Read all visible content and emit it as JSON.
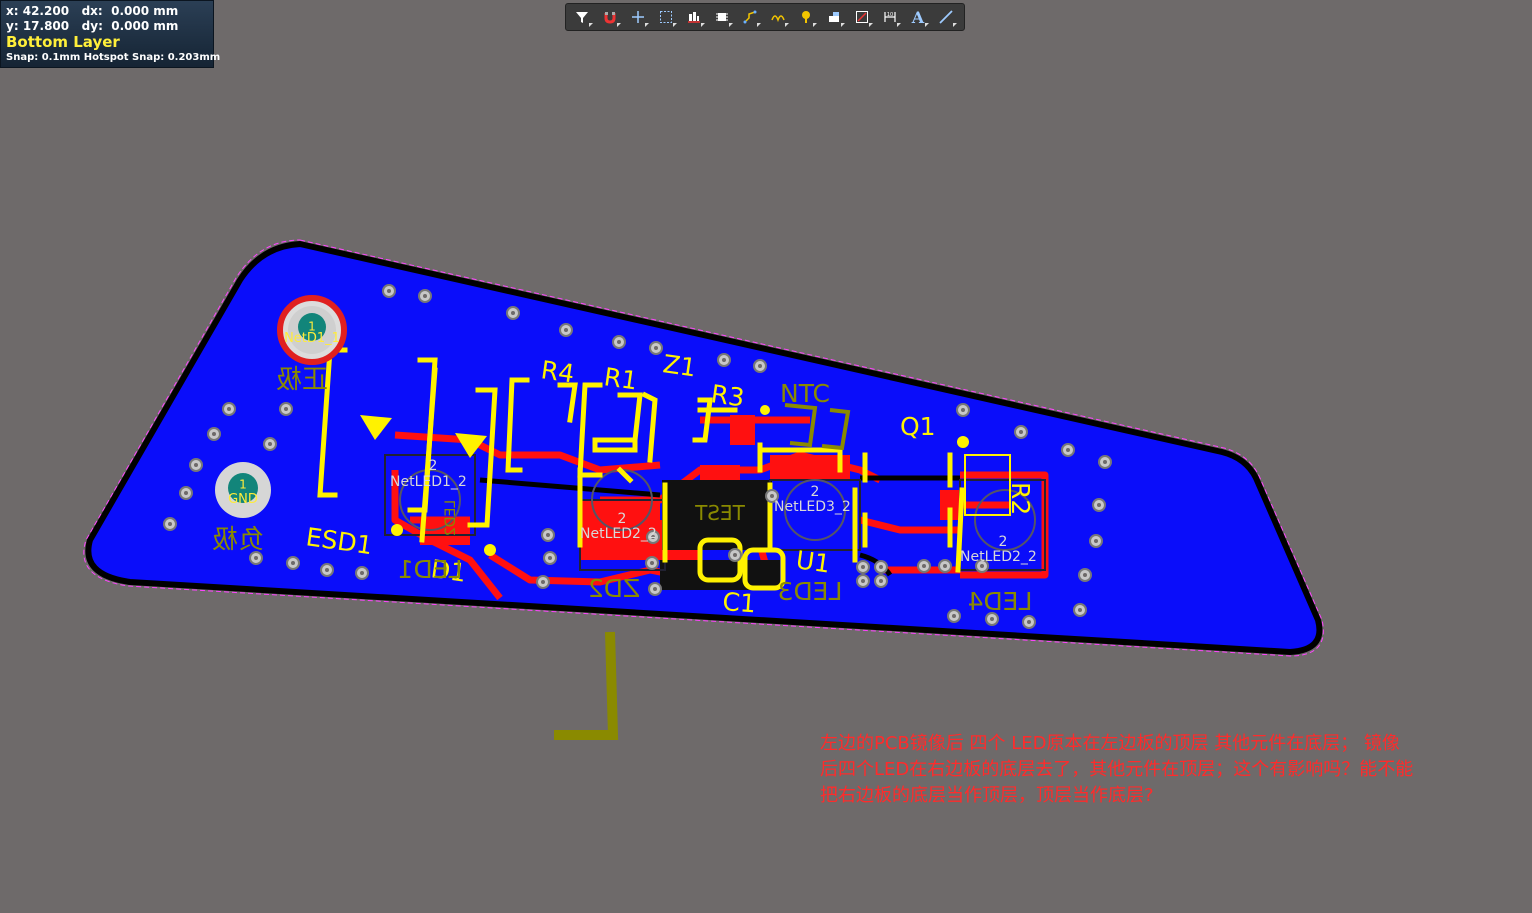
{
  "hud": {
    "x_label": "x:",
    "x_value": "42.200",
    "dx_label": "dx:",
    "dx_value": "0.000 mm",
    "y_label": "y:",
    "y_value": "17.800",
    "dy_label": "dy:",
    "dy_value": "0.000 mm",
    "layer": "Bottom Layer",
    "snap": "Snap: 0.1mm Hotspot Snap: 0.203mm"
  },
  "toolbar": {
    "tools": [
      {
        "name": "filter-icon"
      },
      {
        "name": "magnet-icon"
      },
      {
        "name": "crosshair-icon"
      },
      {
        "name": "select-rectangle-icon"
      },
      {
        "name": "align-icon"
      },
      {
        "name": "component-icon"
      },
      {
        "name": "route-icon"
      },
      {
        "name": "differential-route-icon"
      },
      {
        "name": "probe-icon"
      },
      {
        "name": "fill-icon"
      },
      {
        "name": "region-icon"
      },
      {
        "name": "dimension-icon"
      },
      {
        "name": "text-icon",
        "glyph": "A"
      },
      {
        "name": "line-icon"
      }
    ]
  },
  "board": {
    "colors": {
      "background": "#6e6a6a",
      "copper_bottom": "#0a0dfa",
      "trace_top": "#ff1010",
      "silkscreen": "#fff200",
      "silkscreen_bottom": "#8a8a00",
      "outline": "#000000",
      "via": "#c8c8c8"
    },
    "pads": [
      {
        "id": "pad-netd1",
        "num": "1",
        "net": "NetD1_1",
        "label": "正极"
      },
      {
        "id": "pad-gnd",
        "num": "1",
        "net": "GND",
        "label": "负极"
      }
    ],
    "designators": [
      "R4",
      "R1",
      "Z1",
      "R3",
      "NTC",
      "Q1",
      "R2",
      "ESD1",
      "D1",
      "U1",
      "C1",
      "TEST",
      "ZD2"
    ],
    "bottom_designators": [
      "LED1",
      "LED2",
      "LED3",
      "LED4"
    ],
    "net_labels": [
      "NetLED1_2",
      "NetLED2_2",
      "NetLED3_2",
      "NetLED2_2"
    ],
    "pad_numbers": [
      "2",
      "2",
      "2",
      "2"
    ]
  },
  "note": {
    "lines": [
      "左边的PCB镜像后 四个 LED原本在左边板的顶层  其他元件在底层；  镜像",
      "后四个LED在右边板的底层去了，其他元件在顶层；这个有影响吗？能不能",
      "把右边板的底层当作顶层，顶层当作底层?"
    ]
  }
}
